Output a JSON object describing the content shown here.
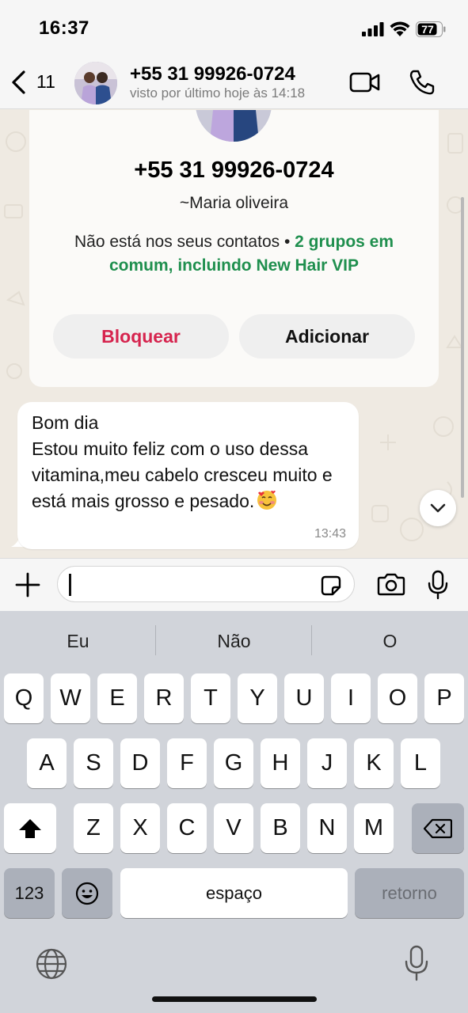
{
  "status_bar": {
    "time": "16:37",
    "battery": "77"
  },
  "header": {
    "back_count": "11",
    "contact_number": "+55 31 99926-0724",
    "last_seen": "visto por último hoje às 14:18"
  },
  "contact_card": {
    "phone": "+55 31 99926-0724",
    "username": "~Maria oliveira",
    "info_prefix": "Não está nos seus contatos • ",
    "info_groups": "2 grupos em comum, incluindo New Hair VIP",
    "block_label": "Bloquear",
    "add_label": "Adicionar"
  },
  "message": {
    "text": "Bom dia\nEstou muito feliz com o uso dessa vitamina,meu cabelo cresceu muito e está mais grosso e pesado.",
    "emoji": "smiling-face-with-hearts",
    "time": "13:43"
  },
  "composer": {
    "value": ""
  },
  "keyboard": {
    "suggestions": [
      "Eu",
      "Não",
      "O"
    ],
    "row1": [
      "Q",
      "W",
      "E",
      "R",
      "T",
      "Y",
      "U",
      "I",
      "O",
      "P"
    ],
    "row2": [
      "A",
      "S",
      "D",
      "F",
      "G",
      "H",
      "J",
      "K",
      "L"
    ],
    "row3": [
      "Z",
      "X",
      "C",
      "V",
      "B",
      "N",
      "M"
    ],
    "numbers_label": "123",
    "space_label": "espaço",
    "return_label": "retorno"
  },
  "colors": {
    "block_red": "#d6244e",
    "group_green": "#1f8f4e",
    "chat_bg": "#efeae2"
  }
}
